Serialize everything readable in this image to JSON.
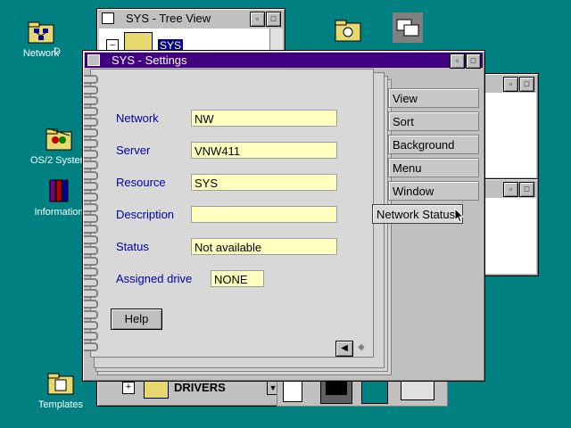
{
  "desktop": {
    "icons": [
      {
        "label": "Network"
      },
      {
        "label": "D"
      },
      {
        "label": "OS/2 System"
      },
      {
        "label": "Information"
      },
      {
        "label": "Templates"
      }
    ]
  },
  "tree_window": {
    "title": "SYS - Tree View",
    "root_label": "SYS"
  },
  "settings_window": {
    "title": "SYS - Settings",
    "fields": [
      {
        "label": "Network",
        "value": "NW"
      },
      {
        "label": "Server",
        "value": "VNW411"
      },
      {
        "label": "Resource",
        "value": "SYS"
      },
      {
        "label": "Description",
        "value": ""
      },
      {
        "label": "Status",
        "value": "Not available"
      }
    ],
    "assigned_drive": {
      "label": "Assigned drive",
      "value": "NONE"
    },
    "help_label": "Help",
    "tabs": [
      "View",
      "Sort",
      "Background",
      "Menu",
      "Window",
      "Network Status"
    ],
    "active_tab": "Network Status"
  },
  "drives_bar": {
    "folder_label": "DRIVERS"
  }
}
